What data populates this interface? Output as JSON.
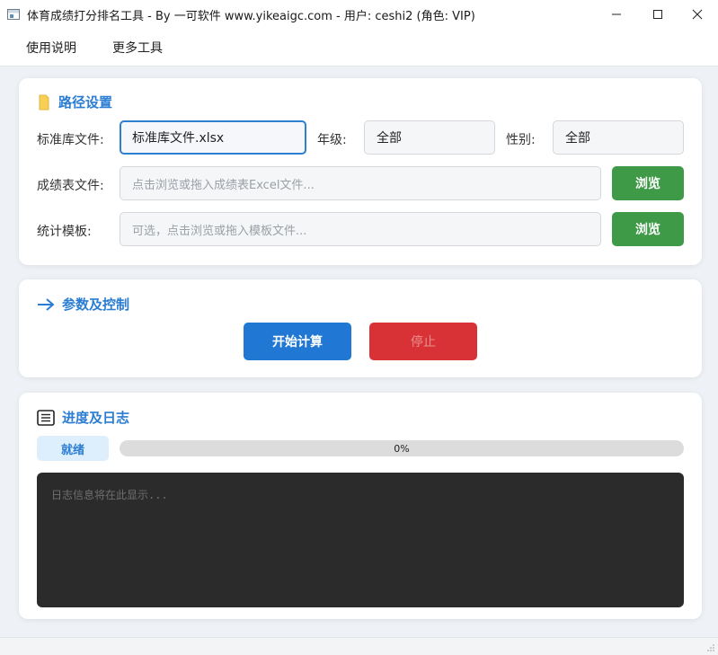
{
  "window": {
    "title": "体育成绩打分排名工具 - By 一可软件 www.yikeaigc.com - 用户: ceshi2 (角色: VIP)",
    "minimize": "—",
    "maximize": "☐",
    "close": "✕"
  },
  "menu": {
    "items": [
      {
        "label": "使用说明"
      },
      {
        "label": "更多工具"
      }
    ]
  },
  "path_section": {
    "title": "路径设置",
    "icon": "folder-icon",
    "standard_label": "标准库文件:",
    "standard_value": "标准库文件.xlsx",
    "grade_label": "年级:",
    "grade_value": "全部",
    "gender_label": "性别:",
    "gender_value": "全部",
    "score_label": "成绩表文件:",
    "score_placeholder": "点击浏览或拖入成绩表Excel文件...",
    "score_browse": "浏览",
    "template_label": "统计模板:",
    "template_placeholder": "可选，点击浏览或拖入模板文件...",
    "template_browse": "浏览"
  },
  "control_section": {
    "title": "参数及控制",
    "icon": "arrow-right-icon",
    "start_label": "开始计算",
    "stop_label": "停止"
  },
  "progress_section": {
    "title": "进度及日志",
    "icon": "document-icon",
    "status": "就绪",
    "progress_value": 0,
    "progress_text": "0%",
    "log_placeholder": "日志信息将在此显示..."
  },
  "colors": {
    "accent": "#2b7cd3",
    "green": "#3f9a47",
    "blue": "#2178d4",
    "red": "#d93236",
    "log_bg": "#2b2b2b"
  }
}
